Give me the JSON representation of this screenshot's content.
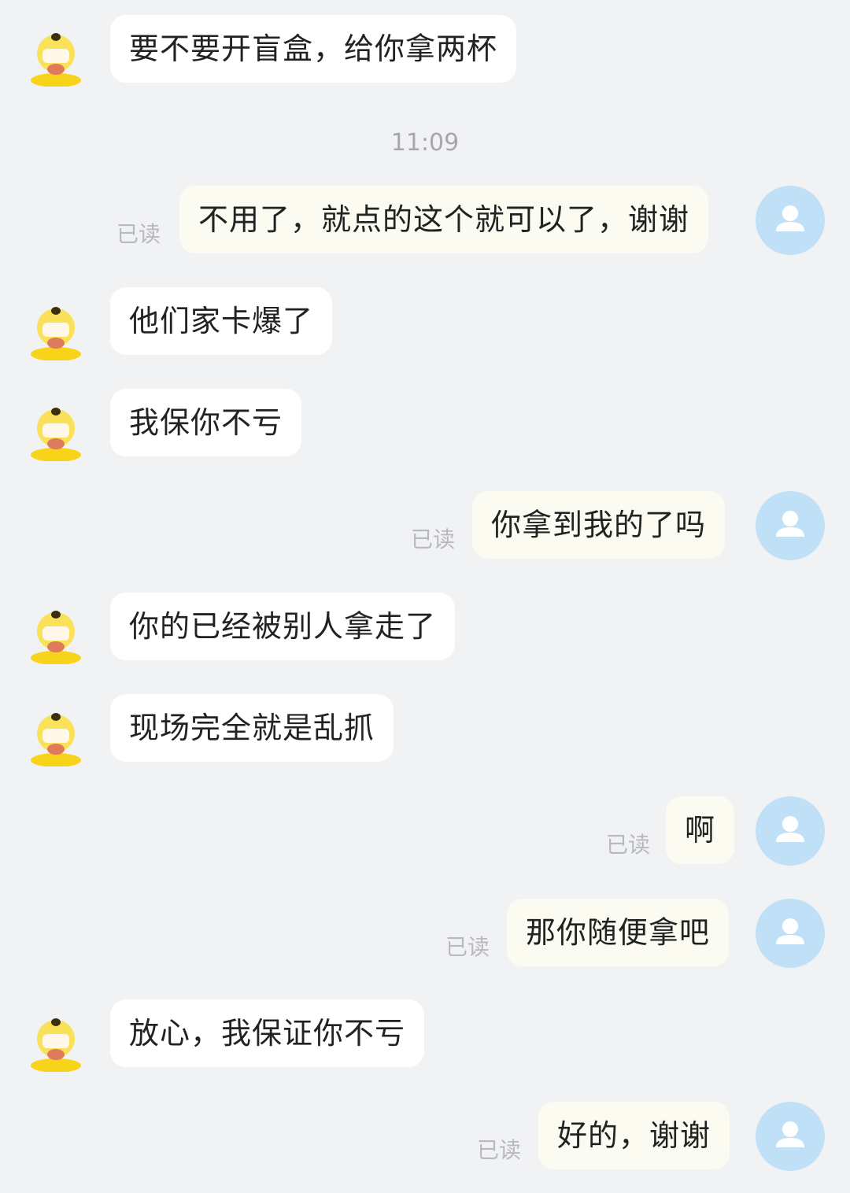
{
  "timestamp": "11:09",
  "read_label": "已读",
  "messages": [
    {
      "from": "them",
      "text": "要不要开盲盒，给你拿两杯"
    },
    {
      "from": "me",
      "text": "不用了，就点的这个就可以了，谢谢",
      "read": "已读"
    },
    {
      "from": "them",
      "text": "他们家卡爆了"
    },
    {
      "from": "them",
      "text": "我保你不亏"
    },
    {
      "from": "me",
      "text": "你拿到我的了吗",
      "read": "已读"
    },
    {
      "from": "them",
      "text": "你的已经被别人拿走了"
    },
    {
      "from": "them",
      "text": "现场完全就是乱抓"
    },
    {
      "from": "me",
      "text": "啊",
      "read": "已读"
    },
    {
      "from": "me",
      "text": "那你随便拿吧",
      "read": "已读"
    },
    {
      "from": "them",
      "text": "放心，我保证你不亏"
    },
    {
      "from": "me",
      "text": "好的，谢谢",
      "read": "已读"
    }
  ],
  "icons": {
    "their_avatar": "yellow-duck-avatar-icon",
    "my_avatar": "default-user-avatar-icon"
  },
  "colors": {
    "background": "#f1f2f4",
    "their_bubble": "#ffffff",
    "my_bubble": "#fbfbf2",
    "my_avatar": "#bfe0f6",
    "read_text": "#b8b9bc"
  }
}
